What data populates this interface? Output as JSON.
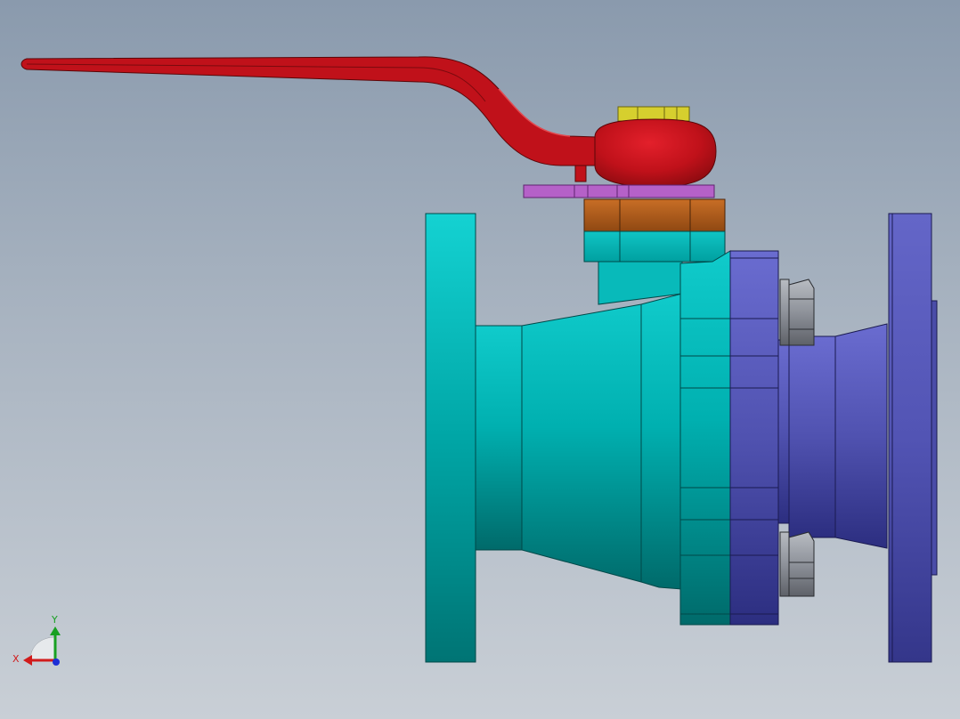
{
  "viewport": {
    "background_top": "#8a9aad",
    "background_bottom": "#c9cfd6"
  },
  "model": {
    "name": "ball-valve",
    "part_colors": {
      "handle": "#c0111a",
      "stem_nut": "#d6cf2e",
      "stop_plate": "#b561c8",
      "gland_nut": "#b8621e",
      "body": "#00b7b7",
      "end_cap": "#5a5cb8",
      "bolt": "#8e929a"
    }
  },
  "triad": {
    "x_label": "X",
    "y_label": "Y",
    "x_color": "#d11b1b",
    "y_color": "#18a022",
    "z_color": "#1d2fd6"
  }
}
